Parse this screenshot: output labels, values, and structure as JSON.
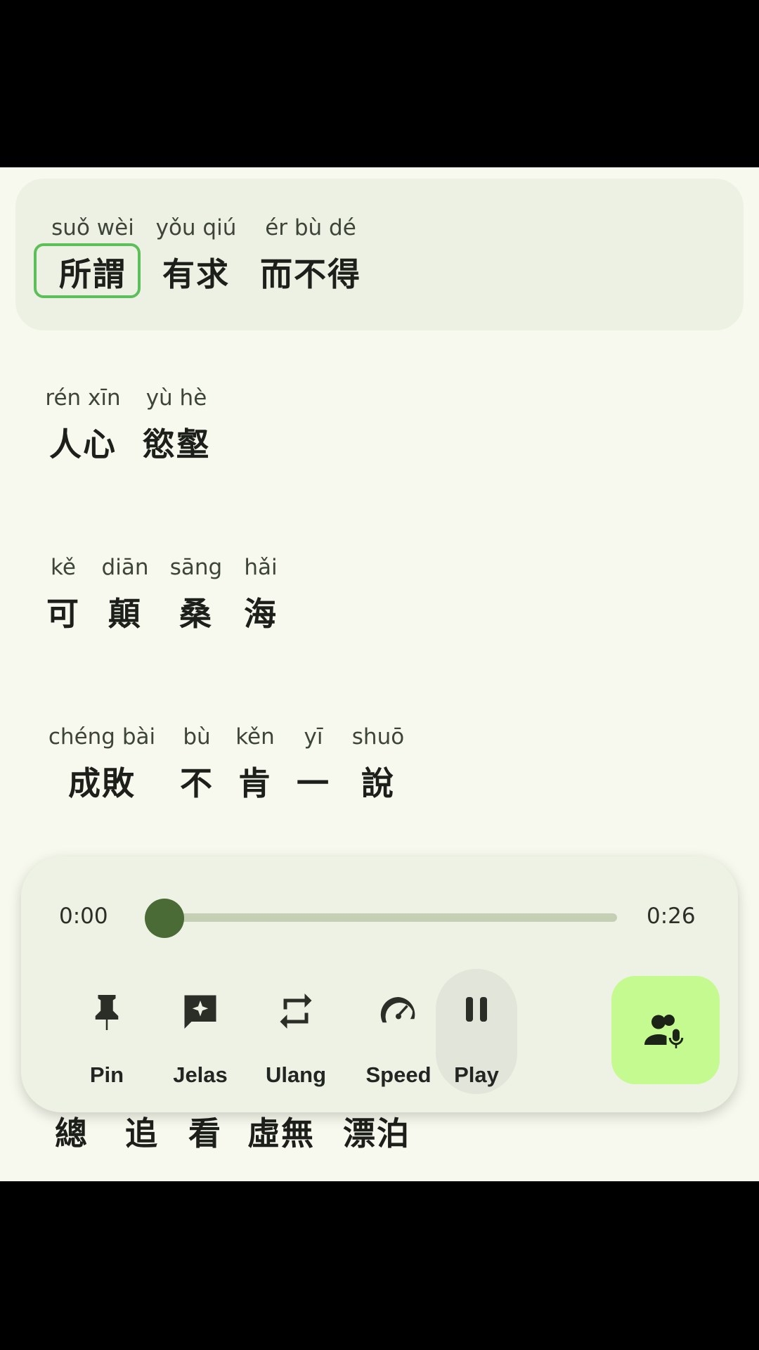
{
  "lyrics": [
    {
      "words": [
        {
          "py": "suǒ wèi",
          "hz": "所謂"
        },
        {
          "py": "yǒu qiú",
          "hz": "有求"
        },
        {
          "py": "ér bù dé",
          "hz": "而不得"
        }
      ]
    },
    {
      "words": [
        {
          "py": "rén xīn",
          "hz": "人心"
        },
        {
          "py": "yù hè",
          "hz": "慾壑"
        }
      ]
    },
    {
      "words": [
        {
          "py": "kě",
          "hz": "可"
        },
        {
          "py": "diān",
          "hz": "顛"
        },
        {
          "py": "sāng",
          "hz": "桑"
        },
        {
          "py": "hǎi",
          "hz": "海"
        }
      ]
    },
    {
      "words": [
        {
          "py": "chéng bài",
          "hz": "成敗"
        },
        {
          "py": "bù",
          "hz": "不"
        },
        {
          "py": "kěn",
          "hz": "肯"
        },
        {
          "py": "yī",
          "hz": "一"
        },
        {
          "py": "shuō",
          "hz": "說"
        }
      ]
    },
    {
      "words": [
        {
          "hz": "總"
        },
        {
          "hz": "追"
        },
        {
          "hz": "看"
        },
        {
          "hz": "虛無"
        },
        {
          "hz": "漂泊"
        }
      ]
    }
  ],
  "active_word": "所謂",
  "player": {
    "current_time": "0:00",
    "total_time": "0:26",
    "progress": 0.0,
    "controls": [
      {
        "label": "Pin",
        "icon": "pin-icon"
      },
      {
        "label": "Jelas",
        "icon": "sparkle-chat-icon"
      },
      {
        "label": "Ulang",
        "icon": "repeat-icon"
      },
      {
        "label": "Speed",
        "icon": "speedometer-icon"
      },
      {
        "label": "Play",
        "icon": "pause-icon"
      }
    ],
    "voice_icon": "people-mic-icon"
  },
  "colors": {
    "accent": "#4a6b35",
    "highlight": "#5cbf5a",
    "voice_button": "#c4fa8f",
    "background": "#f7f9ee"
  }
}
